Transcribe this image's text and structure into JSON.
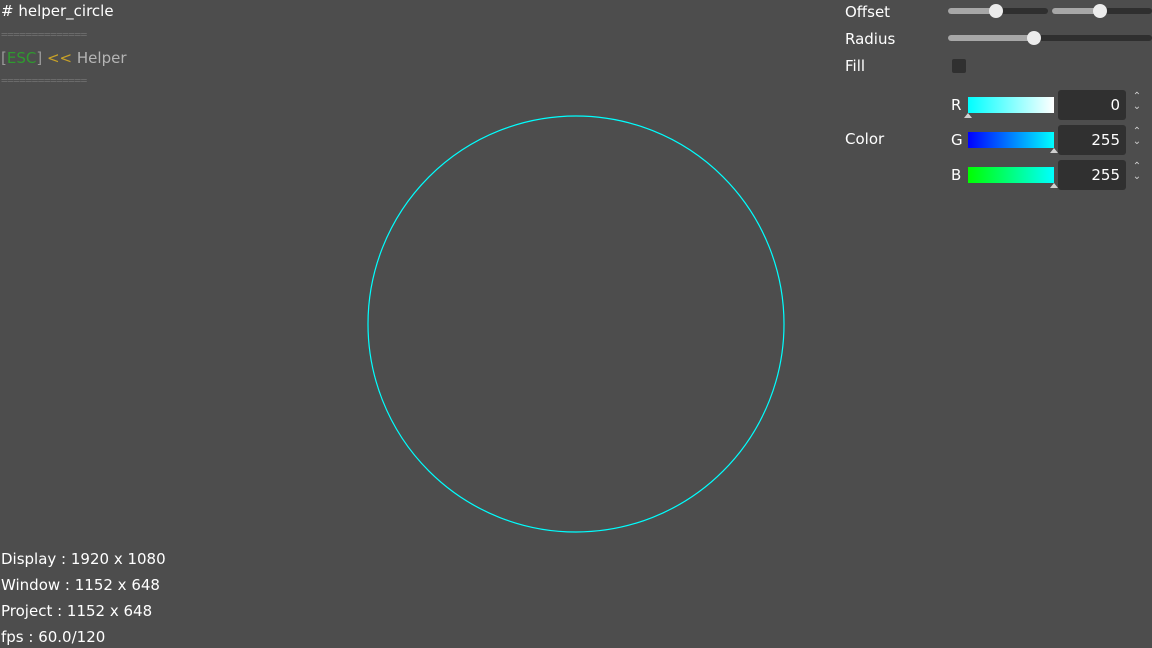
{
  "title": "# helper_circle",
  "separator": "==============",
  "nav": {
    "open_bracket": "[",
    "key": "ESC",
    "close_bracket": "]",
    "arrow": "<<",
    "back_label": "Helper"
  },
  "stats": {
    "display": "Display : 1920 x 1080",
    "window": "Window : 1152 x 648",
    "project": "Project : 1152 x 648",
    "fps": "fps : 60.0/120"
  },
  "panel": {
    "offset_label": "Offset",
    "offset_x_level": 0.48,
    "offset_y_level": 0.48,
    "radius_label": "Radius",
    "radius_level": 0.42,
    "fill_label": "Fill",
    "fill_checked": false,
    "color_label": "Color",
    "channels": [
      {
        "label": "R",
        "value": "0",
        "level": 0.0
      },
      {
        "label": "G",
        "value": "255",
        "level": 1.0
      },
      {
        "label": "B",
        "value": "255",
        "level": 1.0
      }
    ],
    "spin_up": "⌃",
    "spin_down": "⌄"
  },
  "circle": {
    "stroke_color": "#00ffff",
    "filled": false
  },
  "colors": {
    "background": "#4d4d4d",
    "slider_fill": "#a7a7a7",
    "track": "#2f2f2f"
  }
}
